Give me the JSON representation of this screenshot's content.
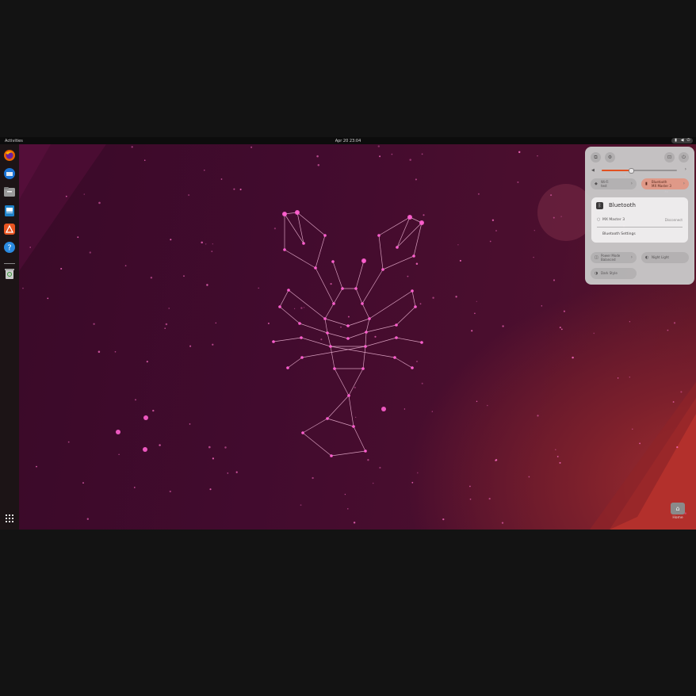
{
  "topbar": {
    "activities": "Activities",
    "clock": "Apr 20 23:04"
  },
  "dock": {
    "apps": [
      {
        "name": "firefox",
        "icon": "firefox-icon",
        "color": "#e66000"
      },
      {
        "name": "thunderbird",
        "icon": "thunderbird-icon",
        "color": "#1b73d4"
      },
      {
        "name": "files",
        "icon": "files-icon",
        "color": "#9a9a9a"
      },
      {
        "name": "writer",
        "icon": "writer-icon",
        "color": "#1e82c8"
      },
      {
        "name": "app-center",
        "icon": "app-center-icon",
        "color": "#e95420"
      },
      {
        "name": "help",
        "icon": "help-icon",
        "color": "#2a8ae0"
      },
      {
        "name": "trash",
        "icon": "trash-icon",
        "color": "#bdbdbd"
      }
    ]
  },
  "quick_settings": {
    "volume_level": 0.38,
    "wifi": {
      "title": "Wi-Fi",
      "subtitle": "test"
    },
    "bluetooth": {
      "title": "Bluetooth",
      "subtitle": "MX Master 3"
    },
    "bt_menu": {
      "title": "Bluetooth",
      "device_name": "MX Master 3",
      "device_status": "Disconnect",
      "settings_label": "Bluetooth Settings"
    },
    "power_mode": {
      "title": "Power Mode",
      "subtitle": "Balanced"
    },
    "night_light": "Night Light",
    "dark_style": "Dark Style"
  },
  "desktop": {
    "home_label": "Home"
  },
  "colors": {
    "accent": "#e95420",
    "star": "#ff5fcf"
  }
}
